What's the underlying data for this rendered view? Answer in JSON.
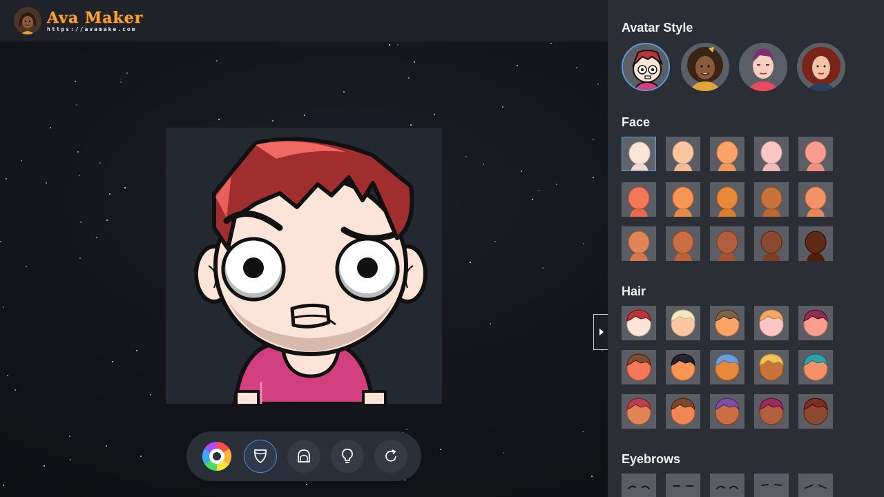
{
  "app": {
    "name": "Ava Maker",
    "url": "https://avamake.com"
  },
  "panel": {
    "sections": {
      "avatar_style": "Avatar Style",
      "face": "Face",
      "hair": "Hair",
      "eyebrows": "Eyebrows"
    },
    "styles": [
      "cartoon-boy",
      "curly-woman",
      "punk-man",
      "red-curly-woman"
    ],
    "selected_style_index": 0,
    "face_skin_tones": [
      "#fde4d9",
      "#fcc7a2",
      "#fca368",
      "#fcc6c4",
      "#fa9d8e",
      "#f47758",
      "#f89555",
      "#e8893a",
      "#c8733c",
      "#f49166",
      "#e08555",
      "#cb6d45",
      "#b0603f",
      "#8a4a31",
      "#5e2a14"
    ],
    "selected_face_index": 0,
    "hair_options": [
      {
        "skin": "#fde4d9",
        "hair": "#b8353a"
      },
      {
        "skin": "#fcc7a2",
        "hair": "#f2e8bd"
      },
      {
        "skin": "#fca368",
        "hair": "#7a6348"
      },
      {
        "skin": "#fcc6c4",
        "hair": "#f4a868"
      },
      {
        "skin": "#fa9d8e",
        "hair": "#8e2f57"
      },
      {
        "skin": "#f47758",
        "hair": "#7b4e33"
      },
      {
        "skin": "#f89555",
        "hair": "#2a2233"
      },
      {
        "skin": "#e8893a",
        "hair": "#6c9fd8"
      },
      {
        "skin": "#c8733c",
        "hair": "#f0c25a"
      },
      {
        "skin": "#f49166",
        "hair": "#2fa3a8"
      },
      {
        "skin": "#e08555",
        "hair": "#b5434a"
      },
      {
        "skin": "#f08755",
        "hair": "#7a4a2c"
      },
      {
        "skin": "#cb6d45",
        "hair": "#7d4fa0"
      },
      {
        "skin": "#b0603f",
        "hair": "#922f5a"
      },
      {
        "skin": "#8a4a31",
        "hair": "#7a2f22"
      }
    ],
    "eyebrow_count": 5
  },
  "toolbar": [
    "color-wheel",
    "face-shape",
    "hair",
    "idea",
    "reset"
  ],
  "theme": {
    "accent": "#5b9bd9",
    "logo_color": "#f6a33b",
    "avatar_hair": "#a12e2f",
    "avatar_hair_light": "#f26864",
    "avatar_skin": "#fde4d9",
    "avatar_shirt": "#d13f7e"
  }
}
